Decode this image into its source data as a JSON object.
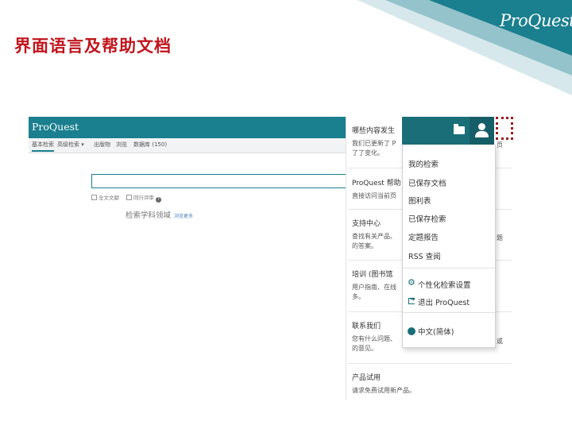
{
  "slide": {
    "title": "界面语言及帮助文档",
    "logo": "ProQuest",
    "colors": {
      "title": "#c0141c",
      "teal": "#1a7f8e",
      "dark_teal": "#1a6e78",
      "highlight": "#9a1c20"
    }
  },
  "app": {
    "brand": "ProQuest",
    "nav": [
      "基本检索",
      "高级检索 ▾",
      "出版物",
      "浏览",
      "数据库 (150)"
    ],
    "options": {
      "fulltext": "全文文献",
      "peer": "同行评审"
    },
    "browse": {
      "label": "检索学科领域",
      "link": "浏览更多"
    }
  },
  "info_panel": {
    "sections": [
      {
        "title": "哪些内容发生",
        "body": [
          "我们已更新了 P",
          "了了变化。"
        ]
      },
      {
        "title": "ProQuest 帮助",
        "body": [
          "直接访问当前页"
        ]
      },
      {
        "title": "支持中心",
        "body": [
          "查找有关产品、",
          "的答案。"
        ]
      },
      {
        "title": "培训 (图书馆",
        "body": [
          "用户指南、在线",
          "多。"
        ]
      },
      {
        "title": "联系我们",
        "body": [
          "您有什么问题、",
          "的意见。"
        ]
      },
      {
        "title": "产品试用",
        "body": [
          "请求免费试用新产品。"
        ]
      }
    ],
    "right_edge_texts": [
      "页",
      "题",
      "或"
    ]
  },
  "account_menu": {
    "icons": {
      "folder": "folder-icon",
      "account": "person-icon"
    },
    "items": [
      "我的检索",
      "已保存文档",
      "图利表",
      "已保存检索",
      "定题报告",
      "RSS 查阅"
    ],
    "settings": "个性化检索设置",
    "logout": "退出 ProQuest",
    "language": "中文(简体)"
  }
}
